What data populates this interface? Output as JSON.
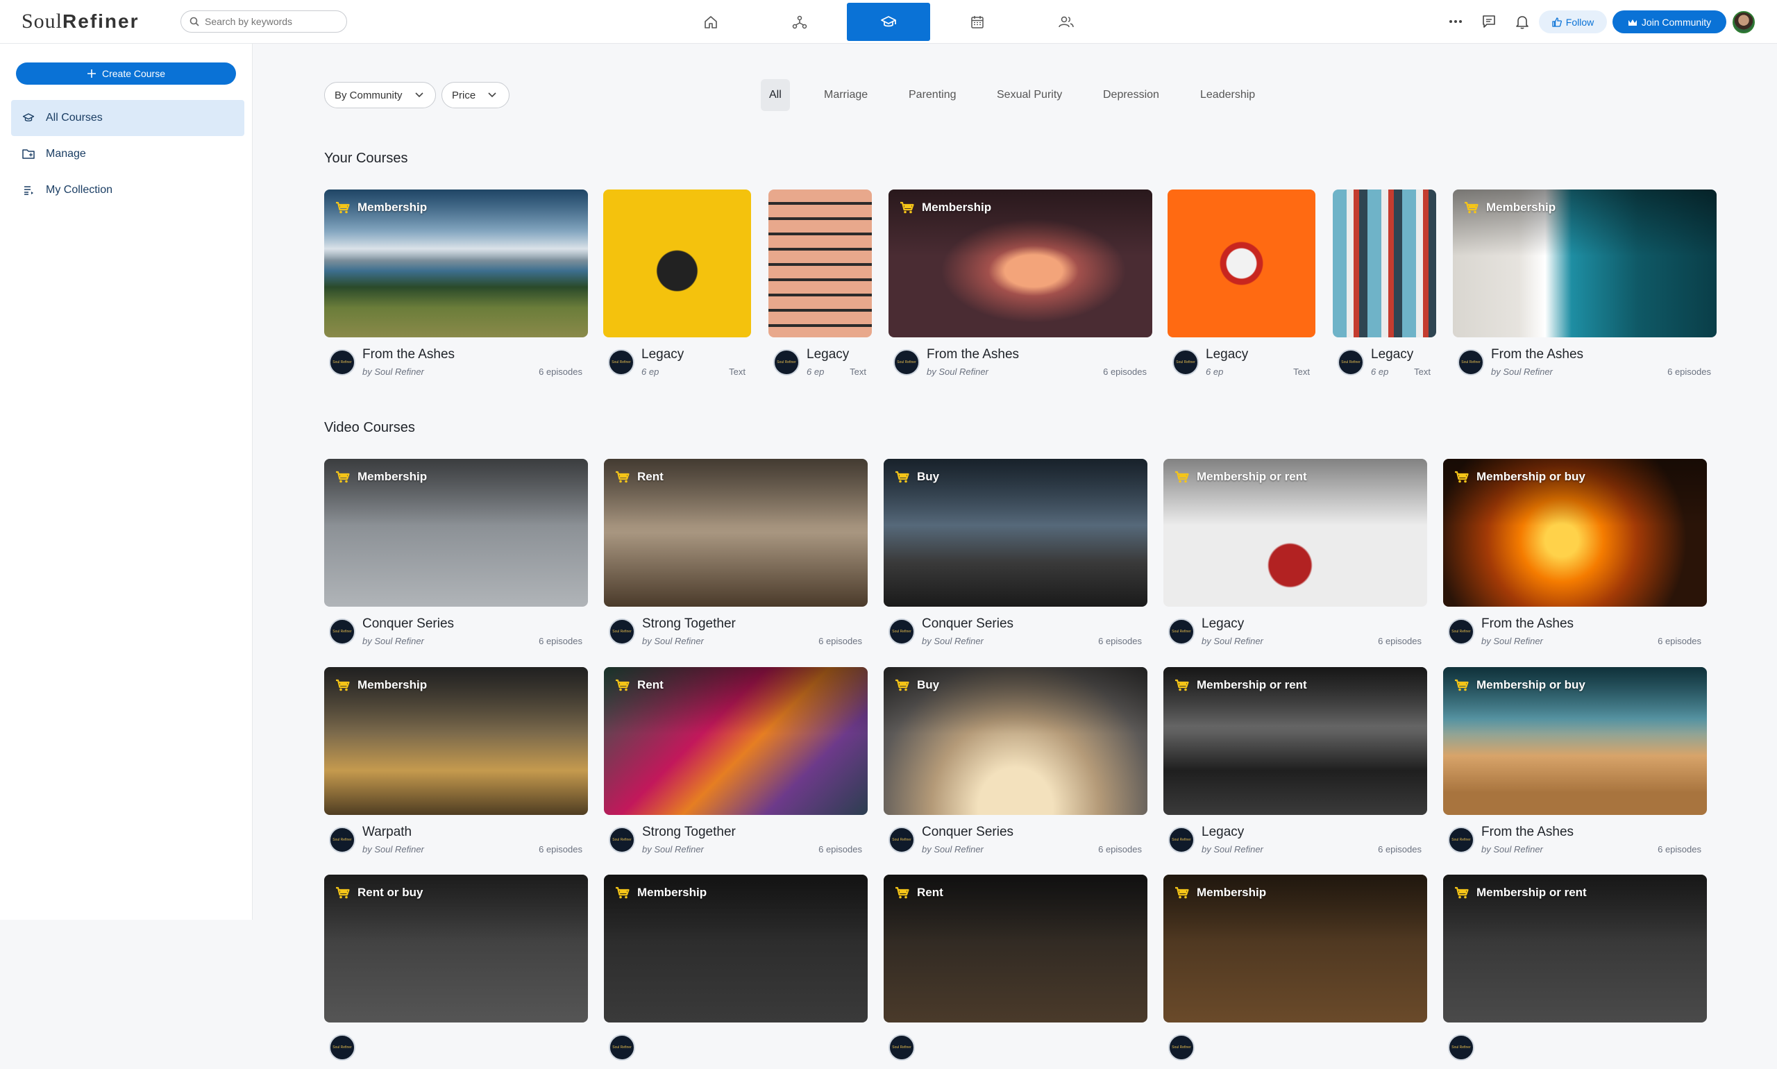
{
  "app": {
    "logo_soul": "Soul",
    "logo_refiner": "Refiner"
  },
  "search": {
    "placeholder": "Search by keywords"
  },
  "nav": [
    "home-icon",
    "network-icon",
    "courses-icon",
    "calendar-icon",
    "people-icon"
  ],
  "header": {
    "follow_label": "Follow",
    "join_label": "Join Community"
  },
  "sidebar": {
    "create_label": "Create Course",
    "items": [
      {
        "label": "All Courses",
        "icon": "courses-icon"
      },
      {
        "label": "Manage",
        "icon": "folder-icon"
      },
      {
        "label": "My Collection",
        "icon": "list-icon"
      }
    ]
  },
  "filters": {
    "community": "By Community",
    "price": "Price"
  },
  "categories": [
    "All",
    "Marriage",
    "Parenting",
    "Sexual Purity",
    "Depression",
    "Leadership"
  ],
  "sections": {
    "your_courses": "Your Courses",
    "video_courses": "Video Courses"
  },
  "your_courses": [
    {
      "title": "From the Ashes",
      "badge": "Membership",
      "by": "by Soul Refiner",
      "meta": "6 episodes"
    },
    {
      "title": "Legacy",
      "badge": "",
      "by": "6 ep",
      "meta": "Text"
    },
    {
      "title": "Legacy",
      "badge": "",
      "by": "6 ep",
      "meta": "Text"
    },
    {
      "title": "From the Ashes",
      "badge": "Membership",
      "by": "by Soul Refiner",
      "meta": "6 episodes"
    },
    {
      "title": "Legacy",
      "badge": "",
      "by": "6 ep",
      "meta": "Text"
    },
    {
      "title": "Legacy",
      "badge": "",
      "by": "6 ep",
      "meta": "Text"
    },
    {
      "title": "From the Ashes",
      "badge": "Membership",
      "by": "by Soul Refiner",
      "meta": "6 episodes"
    }
  ],
  "video_courses": [
    {
      "title": "Conquer Series",
      "badge": "Membership",
      "by": "by Soul Refiner",
      "meta": "6 episodes"
    },
    {
      "title": "Strong Together",
      "badge": "Rent",
      "by": "by Soul Refiner",
      "meta": "6 episodes"
    },
    {
      "title": "Conquer Series",
      "badge": "Buy",
      "by": "by Soul Refiner",
      "meta": "6 episodes"
    },
    {
      "title": "Legacy",
      "badge": "Membership or rent",
      "by": "by Soul Refiner",
      "meta": "6 episodes"
    },
    {
      "title": "From the Ashes",
      "badge": "Membership or buy",
      "by": "by Soul Refiner",
      "meta": "6 episodes"
    },
    {
      "title": "Warpath",
      "badge": "Membership",
      "by": "by Soul Refiner",
      "meta": "6 episodes"
    },
    {
      "title": "Strong Together",
      "badge": "Rent",
      "by": "by Soul Refiner",
      "meta": "6 episodes"
    },
    {
      "title": "Conquer Series",
      "badge": "Buy",
      "by": "by Soul Refiner",
      "meta": "6 episodes"
    },
    {
      "title": "Legacy",
      "badge": "Membership or rent",
      "by": "by Soul Refiner",
      "meta": "6 episodes"
    },
    {
      "title": "From the Ashes",
      "badge": "Membership or buy",
      "by": "by Soul Refiner",
      "meta": "6 episodes"
    },
    {
      "title": "",
      "badge": "Rent or buy",
      "by": "",
      "meta": ""
    },
    {
      "title": "",
      "badge": "Membership",
      "by": "",
      "meta": ""
    },
    {
      "title": "",
      "badge": "Rent",
      "by": "",
      "meta": ""
    },
    {
      "title": "",
      "badge": "Membership",
      "by": "",
      "meta": ""
    },
    {
      "title": "",
      "badge": "Membership or rent",
      "by": "",
      "meta": ""
    }
  ],
  "avatar_text": "Soul Refiner",
  "colors": {
    "accent": "#0a72d6",
    "badge_cart": "#f5c518"
  }
}
